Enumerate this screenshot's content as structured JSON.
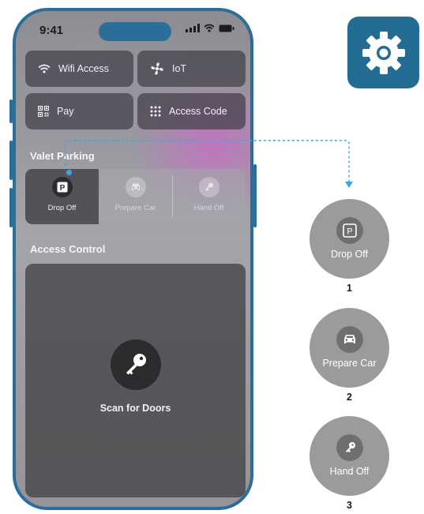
{
  "status": {
    "time": "9:41"
  },
  "tiles": {
    "wifi": {
      "label": "Wifi Access",
      "icon": "wifi-icon"
    },
    "iot": {
      "label": "IoT",
      "icon": "fan-icon"
    },
    "pay": {
      "label": "Pay",
      "icon": "qr-code-icon"
    },
    "code": {
      "label": "Access Code",
      "icon": "keypad-grid-icon"
    }
  },
  "valet": {
    "title": "Valet Parking",
    "items": [
      {
        "label": "Drop Off",
        "icon": "parking-icon",
        "active": true
      },
      {
        "label": "Prepare Car",
        "icon": "car-icon",
        "active": false
      },
      {
        "label": "Hand Off",
        "icon": "key-hand-icon",
        "active": false
      }
    ]
  },
  "access": {
    "title": "Access Control",
    "scan_label": "Scan for Doors",
    "icon": "key-icon"
  },
  "settings": {
    "icon": "gear-icon"
  },
  "steps": [
    {
      "label": "Drop Off",
      "number": "1",
      "icon": "parking-icon"
    },
    {
      "label": "Prepare Car",
      "number": "2",
      "icon": "car-icon"
    },
    {
      "label": "Hand Off",
      "number": "3",
      "icon": "key-hand-icon"
    }
  ],
  "colors": {
    "accent": "#2a6e99",
    "gear_tile": "#236d95",
    "active_dot": "#3aa7e0",
    "step_circle": "#9b9b9b"
  }
}
